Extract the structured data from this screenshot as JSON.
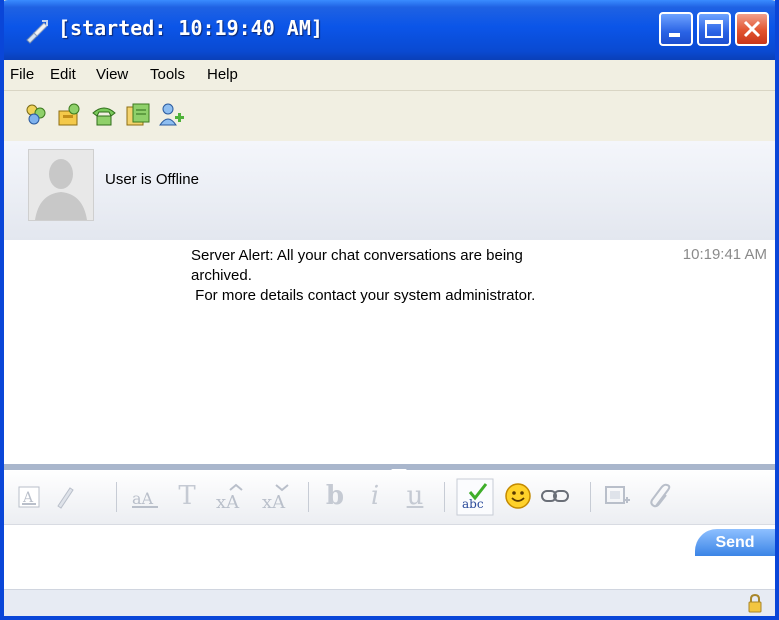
{
  "window": {
    "title": "[started: 10:19:40 AM]",
    "controls": [
      "minimize",
      "maximize",
      "close"
    ]
  },
  "menu": {
    "items": [
      "File",
      "Edit",
      "View",
      "Tools",
      "Help"
    ]
  },
  "toolbar": {
    "icons": [
      "contacts-icon",
      "conference-icon",
      "phone-icon",
      "history-icon",
      "add-user-icon"
    ]
  },
  "user": {
    "status": "User is Offline"
  },
  "chat": {
    "messages": [
      {
        "text_line1": "Server Alert: All your chat conversations are being",
        "text_line2": "archived.",
        "text_line3": " For more details contact your system administrator.",
        "time": "10:19:41 AM"
      }
    ]
  },
  "formatting": {
    "tools": [
      "font-color",
      "highlight",
      "font-face",
      "font-size",
      "grow-font",
      "shrink-font",
      "bold",
      "italic",
      "underline",
      "spellcheck",
      "emoticon",
      "link",
      "screen-capture",
      "attach-file"
    ],
    "letters": {
      "t": "T",
      "b": "b",
      "i": "i",
      "u": "u"
    }
  },
  "composer": {
    "send_label": "Send"
  },
  "colors": {
    "title_blue": "#0a4ad2",
    "send_blue": "#3b84e6",
    "timestamp_gray": "#8a8a8a"
  }
}
